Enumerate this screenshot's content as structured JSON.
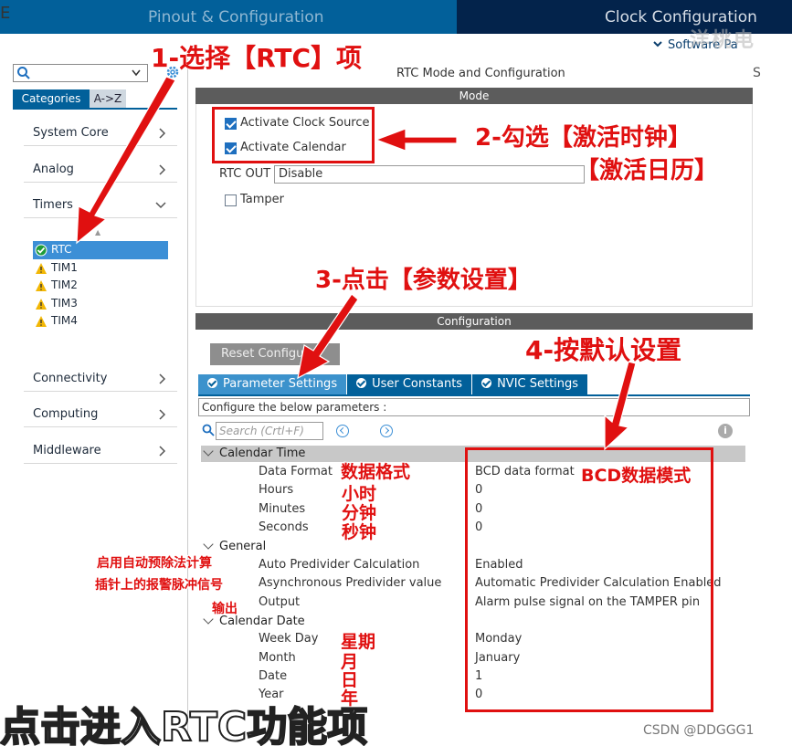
{
  "header": {
    "pinout_tab": "Pinout & Configuration",
    "clock_tab": "Clock Configuration",
    "software_packs": "Software Pa",
    "watermark": "洋桃电",
    "corner_glyph": "E",
    "edge_glyph": "S"
  },
  "left_panel": {
    "search_value": "",
    "tab_categories": "Categories",
    "tab_az": "A->Z",
    "categories": [
      {
        "label": "System Core"
      },
      {
        "label": "Analog"
      },
      {
        "label": "Timers"
      },
      {
        "label": "Connectivity"
      },
      {
        "label": "Computing"
      },
      {
        "label": "Middleware"
      }
    ],
    "timers": [
      {
        "label": "RTC",
        "status": "ok"
      },
      {
        "label": "TIM1",
        "status": "warning"
      },
      {
        "label": "TIM2",
        "status": "warning"
      },
      {
        "label": "TIM3",
        "status": "warning"
      },
      {
        "label": "TIM4",
        "status": "warning"
      }
    ]
  },
  "mode": {
    "section_title": "RTC Mode and Configuration",
    "bar_label": "Mode",
    "activate_clock_source": "Activate Clock Source",
    "activate_calendar": "Activate Calendar",
    "rtc_out_label": "RTC OUT",
    "rtc_out_value": "Disable",
    "tamper": "Tamper"
  },
  "configuration": {
    "bar_label": "Configuration",
    "reset_button": "Reset Configura",
    "tabs": [
      "Parameter Settings",
      "User Constants",
      "NVIC Settings"
    ],
    "configure_text": "Configure the below parameters :",
    "search_placeholder": "Search (Crtl+F)",
    "info": "i",
    "groups": {
      "calendar_time": "Calendar Time",
      "general": "General",
      "calendar_date": "Calendar Date"
    },
    "params": [
      {
        "name": "Data Format",
        "value": "BCD data format"
      },
      {
        "name": "Hours",
        "value": "0"
      },
      {
        "name": "Minutes",
        "value": "0"
      },
      {
        "name": "Seconds",
        "value": "0"
      },
      {
        "name": "Auto Predivider Calculation",
        "value": "Enabled"
      },
      {
        "name": "Asynchronous Predivider value",
        "value": "Automatic Predivider Calculation Enabled"
      },
      {
        "name": "Output",
        "value": "Alarm pulse signal on the TAMPER pin"
      },
      {
        "name": "Week Day",
        "value": "Monday"
      },
      {
        "name": "Month",
        "value": "January"
      },
      {
        "name": "Date",
        "value": "1"
      },
      {
        "name": "Year",
        "value": "0"
      }
    ]
  },
  "annotations": {
    "step1": "1-选择【RTC】项",
    "step2a": "2-勾选【激活时钟】",
    "step2b": "【激活日历】",
    "step3": "3-点击【参数设置】",
    "step4": "4-按默认设置",
    "bcd": "BCD数据模式",
    "data_format": "数据格式",
    "hours": "小时",
    "minutes": "分钟",
    "seconds": "秒钟",
    "auto_calc": "启用自动预除法计算",
    "alarm_pin": "插针上的报警脉冲信号",
    "output": "输出",
    "weekday": "星期",
    "month": "月",
    "date": "日",
    "year": "年",
    "caption": "点击进入RTC功能项",
    "credit": "CSDN @DDGGG1"
  },
  "colors": {
    "header_blue": "#02609a",
    "header_dark": "#03234b",
    "annotation_red": "#e01010",
    "selection_blue": "#3c8fd6"
  }
}
